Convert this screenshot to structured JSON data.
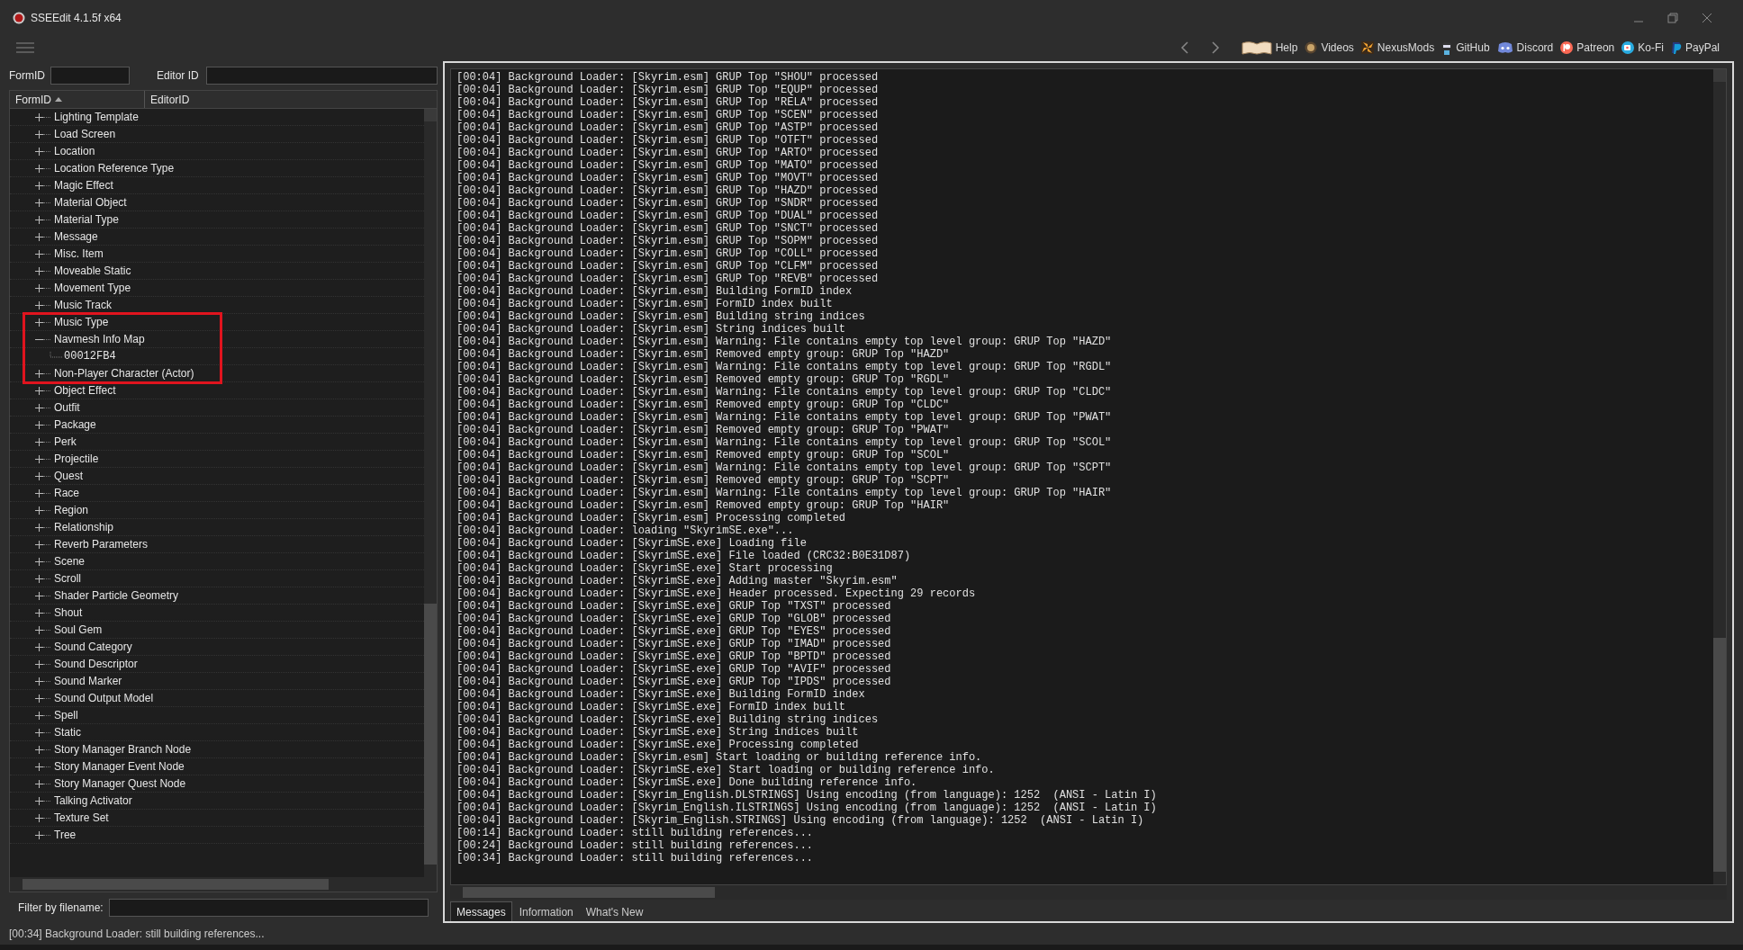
{
  "window": {
    "title": "SSEEdit 4.1.5f x64"
  },
  "toolbar": {
    "links": [
      {
        "label": "Help",
        "kind": "book"
      },
      {
        "label": "Videos",
        "kind": "gp"
      },
      {
        "label": "NexusMods",
        "kind": "nexus"
      },
      {
        "label": "GitHub",
        "kind": "github"
      },
      {
        "label": "Discord",
        "kind": "discord"
      },
      {
        "label": "Patreon",
        "kind": "patreon"
      },
      {
        "label": "Ko-Fi",
        "kind": "kofi"
      },
      {
        "label": "PayPal",
        "kind": "paypal"
      }
    ]
  },
  "search": {
    "formid_label": "FormID",
    "editorid_label": "Editor ID"
  },
  "tree": {
    "columns": [
      "FormID",
      "EditorID"
    ],
    "items": [
      {
        "label": "Lighting Template",
        "expanded": false,
        "annotated": false
      },
      {
        "label": "Load Screen",
        "expanded": false,
        "annotated": false
      },
      {
        "label": "Location",
        "expanded": false,
        "annotated": false
      },
      {
        "label": "Location Reference Type",
        "expanded": false,
        "annotated": false
      },
      {
        "label": "Magic Effect",
        "expanded": false,
        "annotated": false
      },
      {
        "label": "Material Object",
        "expanded": false,
        "annotated": false
      },
      {
        "label": "Material Type",
        "expanded": false,
        "annotated": false
      },
      {
        "label": "Message",
        "expanded": false,
        "annotated": false
      },
      {
        "label": "Misc. Item",
        "expanded": false,
        "annotated": false
      },
      {
        "label": "Moveable Static",
        "expanded": false,
        "annotated": false
      },
      {
        "label": "Movement Type",
        "expanded": false,
        "annotated": false
      },
      {
        "label": "Music Track",
        "expanded": false,
        "annotated": false
      },
      {
        "label": "Music Type",
        "expanded": false,
        "annotated": true
      },
      {
        "label": "Navmesh Info Map",
        "expanded": true,
        "annotated": true,
        "children": [
          {
            "label": "00012FB4",
            "annotated": true
          }
        ]
      },
      {
        "label": "Non-Player Character (Actor)",
        "expanded": false,
        "annotated": true
      },
      {
        "label": "Object Effect",
        "expanded": false,
        "annotated": false
      },
      {
        "label": "Outfit",
        "expanded": false,
        "annotated": false
      },
      {
        "label": "Package",
        "expanded": false,
        "annotated": false
      },
      {
        "label": "Perk",
        "expanded": false,
        "annotated": false
      },
      {
        "label": "Projectile",
        "expanded": false,
        "annotated": false
      },
      {
        "label": "Quest",
        "expanded": false,
        "annotated": false
      },
      {
        "label": "Race",
        "expanded": false,
        "annotated": false
      },
      {
        "label": "Region",
        "expanded": false,
        "annotated": false
      },
      {
        "label": "Relationship",
        "expanded": false,
        "annotated": false
      },
      {
        "label": "Reverb Parameters",
        "expanded": false,
        "annotated": false
      },
      {
        "label": "Scene",
        "expanded": false,
        "annotated": false
      },
      {
        "label": "Scroll",
        "expanded": false,
        "annotated": false
      },
      {
        "label": "Shader Particle Geometry",
        "expanded": false,
        "annotated": false
      },
      {
        "label": "Shout",
        "expanded": false,
        "annotated": false
      },
      {
        "label": "Soul Gem",
        "expanded": false,
        "annotated": false
      },
      {
        "label": "Sound Category",
        "expanded": false,
        "annotated": false
      },
      {
        "label": "Sound Descriptor",
        "expanded": false,
        "annotated": false
      },
      {
        "label": "Sound Marker",
        "expanded": false,
        "annotated": false
      },
      {
        "label": "Sound Output Model",
        "expanded": false,
        "annotated": false
      },
      {
        "label": "Spell",
        "expanded": false,
        "annotated": false
      },
      {
        "label": "Static",
        "expanded": false,
        "annotated": false
      },
      {
        "label": "Story Manager Branch Node",
        "expanded": false,
        "annotated": false
      },
      {
        "label": "Story Manager Event Node",
        "expanded": false,
        "annotated": false
      },
      {
        "label": "Story Manager Quest Node",
        "expanded": false,
        "annotated": false
      },
      {
        "label": "Talking Activator",
        "expanded": false,
        "annotated": false
      },
      {
        "label": "Texture Set",
        "expanded": false,
        "annotated": false
      },
      {
        "label": "Tree",
        "expanded": false,
        "annotated": false
      }
    ]
  },
  "filter": {
    "label": "Filter by filename:"
  },
  "log": {
    "lines": [
      "[00:04] Background Loader: [Skyrim.esm] GRUP Top \"SHOU\" processed",
      "[00:04] Background Loader: [Skyrim.esm] GRUP Top \"EQUP\" processed",
      "[00:04] Background Loader: [Skyrim.esm] GRUP Top \"RELA\" processed",
      "[00:04] Background Loader: [Skyrim.esm] GRUP Top \"SCEN\" processed",
      "[00:04] Background Loader: [Skyrim.esm] GRUP Top \"ASTP\" processed",
      "[00:04] Background Loader: [Skyrim.esm] GRUP Top \"OTFT\" processed",
      "[00:04] Background Loader: [Skyrim.esm] GRUP Top \"ARTO\" processed",
      "[00:04] Background Loader: [Skyrim.esm] GRUP Top \"MATO\" processed",
      "[00:04] Background Loader: [Skyrim.esm] GRUP Top \"MOVT\" processed",
      "[00:04] Background Loader: [Skyrim.esm] GRUP Top \"HAZD\" processed",
      "[00:04] Background Loader: [Skyrim.esm] GRUP Top \"SNDR\" processed",
      "[00:04] Background Loader: [Skyrim.esm] GRUP Top \"DUAL\" processed",
      "[00:04] Background Loader: [Skyrim.esm] GRUP Top \"SNCT\" processed",
      "[00:04] Background Loader: [Skyrim.esm] GRUP Top \"SOPM\" processed",
      "[00:04] Background Loader: [Skyrim.esm] GRUP Top \"COLL\" processed",
      "[00:04] Background Loader: [Skyrim.esm] GRUP Top \"CLFM\" processed",
      "[00:04] Background Loader: [Skyrim.esm] GRUP Top \"REVB\" processed",
      "[00:04] Background Loader: [Skyrim.esm] Building FormID index",
      "[00:04] Background Loader: [Skyrim.esm] FormID index built",
      "[00:04] Background Loader: [Skyrim.esm] Building string indices",
      "[00:04] Background Loader: [Skyrim.esm] String indices built",
      "[00:04] Background Loader: [Skyrim.esm] Warning: File contains empty top level group: GRUP Top \"HAZD\"",
      "[00:04] Background Loader: [Skyrim.esm] Removed empty group: GRUP Top \"HAZD\"",
      "[00:04] Background Loader: [Skyrim.esm] Warning: File contains empty top level group: GRUP Top \"RGDL\"",
      "[00:04] Background Loader: [Skyrim.esm] Removed empty group: GRUP Top \"RGDL\"",
      "[00:04] Background Loader: [Skyrim.esm] Warning: File contains empty top level group: GRUP Top \"CLDC\"",
      "[00:04] Background Loader: [Skyrim.esm] Removed empty group: GRUP Top \"CLDC\"",
      "[00:04] Background Loader: [Skyrim.esm] Warning: File contains empty top level group: GRUP Top \"PWAT\"",
      "[00:04] Background Loader: [Skyrim.esm] Removed empty group: GRUP Top \"PWAT\"",
      "[00:04] Background Loader: [Skyrim.esm] Warning: File contains empty top level group: GRUP Top \"SCOL\"",
      "[00:04] Background Loader: [Skyrim.esm] Removed empty group: GRUP Top \"SCOL\"",
      "[00:04] Background Loader: [Skyrim.esm] Warning: File contains empty top level group: GRUP Top \"SCPT\"",
      "[00:04] Background Loader: [Skyrim.esm] Removed empty group: GRUP Top \"SCPT\"",
      "[00:04] Background Loader: [Skyrim.esm] Warning: File contains empty top level group: GRUP Top \"HAIR\"",
      "[00:04] Background Loader: [Skyrim.esm] Removed empty group: GRUP Top \"HAIR\"",
      "[00:04] Background Loader: [Skyrim.esm] Processing completed",
      "[00:04] Background Loader: loading \"SkyrimSE.exe\"...",
      "[00:04] Background Loader: [SkyrimSE.exe] Loading file",
      "[00:04] Background Loader: [SkyrimSE.exe] File loaded (CRC32:B0E31D87)",
      "[00:04] Background Loader: [SkyrimSE.exe] Start processing",
      "[00:04] Background Loader: [SkyrimSE.exe] Adding master \"Skyrim.esm\"",
      "[00:04] Background Loader: [SkyrimSE.exe] Header processed. Expecting 29 records",
      "[00:04] Background Loader: [SkyrimSE.exe] GRUP Top \"TXST\" processed",
      "[00:04] Background Loader: [SkyrimSE.exe] GRUP Top \"GLOB\" processed",
      "[00:04] Background Loader: [SkyrimSE.exe] GRUP Top \"EYES\" processed",
      "[00:04] Background Loader: [SkyrimSE.exe] GRUP Top \"IMAD\" processed",
      "[00:04] Background Loader: [SkyrimSE.exe] GRUP Top \"BPTD\" processed",
      "[00:04] Background Loader: [SkyrimSE.exe] GRUP Top \"AVIF\" processed",
      "[00:04] Background Loader: [SkyrimSE.exe] GRUP Top \"IPDS\" processed",
      "[00:04] Background Loader: [SkyrimSE.exe] Building FormID index",
      "[00:04] Background Loader: [SkyrimSE.exe] FormID index built",
      "[00:04] Background Loader: [SkyrimSE.exe] Building string indices",
      "[00:04] Background Loader: [SkyrimSE.exe] String indices built",
      "[00:04] Background Loader: [SkyrimSE.exe] Processing completed",
      "[00:04] Background Loader: [Skyrim.esm] Start loading or building reference info.",
      "[00:04] Background Loader: [SkyrimSE.exe] Start loading or building reference info.",
      "[00:04] Background Loader: [SkyrimSE.exe] Done building reference info.",
      "[00:04] Background Loader: [Skyrim_English.DLSTRINGS] Using encoding (from language): 1252  (ANSI - Latin I)",
      "[00:04] Background Loader: [Skyrim_English.ILSTRINGS] Using encoding (from language): 1252  (ANSI - Latin I)",
      "[00:04] Background Loader: [Skyrim_English.STRINGS] Using encoding (from language): 1252  (ANSI - Latin I)",
      "[00:14] Background Loader: still building references...",
      "[00:24] Background Loader: still building references...",
      "[00:34] Background Loader: still building references..."
    ]
  },
  "tabs": [
    {
      "label": "Messages",
      "selected": true
    },
    {
      "label": "Information",
      "selected": false
    },
    {
      "label": "What's New",
      "selected": false
    }
  ],
  "status_bar": {
    "text": "[00:34] Background Loader: still building references..."
  }
}
